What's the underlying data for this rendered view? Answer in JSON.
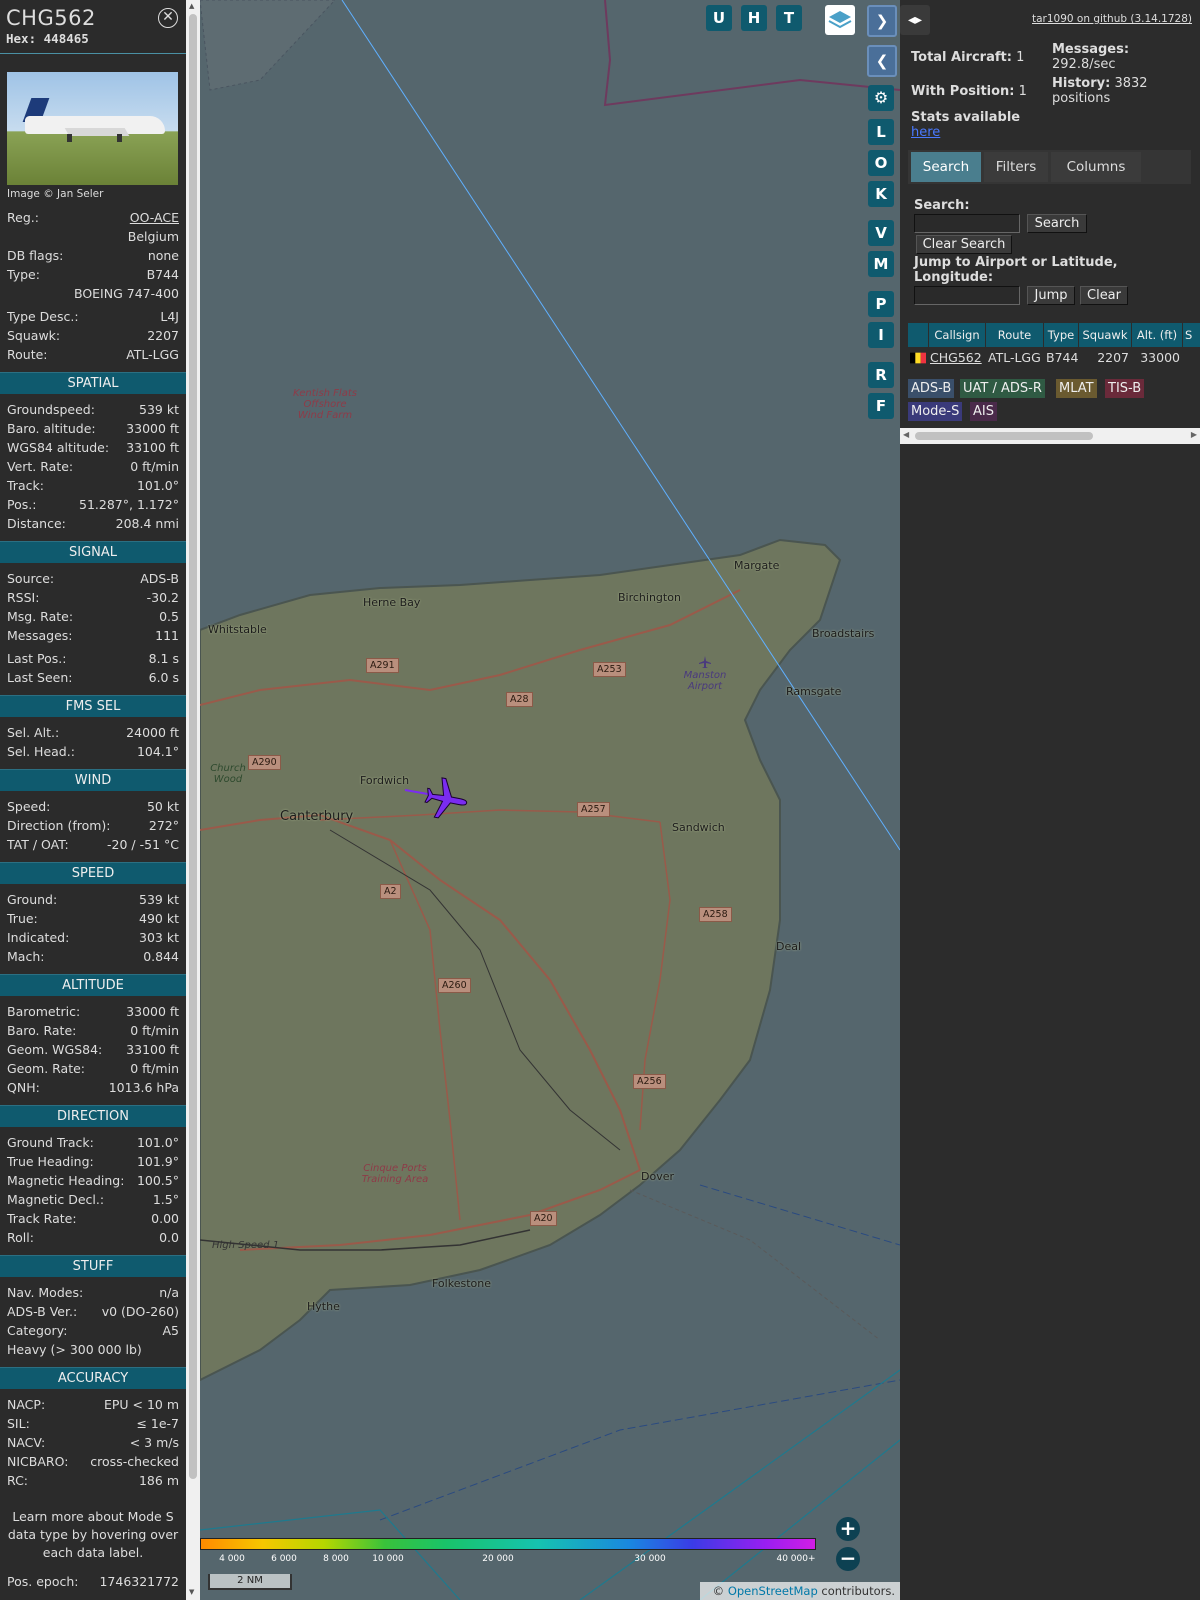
{
  "info": {
    "callsign": "CHG562",
    "hex_label": "Hex:",
    "hex": "448465",
    "close_icon": "x-circle-icon",
    "photo_credit": "Image © Jan Seler",
    "basic": [
      {
        "label": "Reg.:",
        "value": "OO-ACE"
      },
      {
        "value": "Belgium"
      },
      {
        "label": "DB flags:",
        "value": "none"
      },
      {
        "label": "Type:",
        "value": "B744"
      },
      {
        "value": "BOEING 747-400"
      },
      {
        "label": "Type Desc.:",
        "value": "L4J"
      },
      {
        "label": "Squawk:",
        "value": "2207"
      },
      {
        "label": "Route:",
        "value": "ATL-LGG"
      }
    ],
    "sections": [
      {
        "title": "SPATIAL",
        "rows": [
          {
            "label": "Groundspeed:",
            "value": "539 kt"
          },
          {
            "label": "Baro. altitude:",
            "value": "33000 ft"
          },
          {
            "label": "WGS84 altitude:",
            "value": "33100 ft"
          },
          {
            "label": "Vert. Rate:",
            "value": "0 ft/min"
          },
          {
            "label": "Track:",
            "value": "101.0°"
          },
          {
            "label": "Pos.:",
            "value": "51.287°, 1.172°"
          },
          {
            "label": "Distance:",
            "value": "208.4 nmi"
          }
        ]
      },
      {
        "title": "SIGNAL",
        "rows": [
          {
            "label": "Source:",
            "value": "ADS-B"
          },
          {
            "label": "RSSI:",
            "value": "-30.2"
          },
          {
            "label": "Msg. Rate:",
            "value": "0.5"
          },
          {
            "label": "Messages:",
            "value": "111"
          },
          {
            "label": "Last Pos.:",
            "value": "8.1 s"
          },
          {
            "label": "Last Seen:",
            "value": "6.0 s"
          }
        ]
      },
      {
        "title": "FMS SEL",
        "rows": [
          {
            "label": "Sel. Alt.:",
            "value": "24000 ft"
          },
          {
            "label": "Sel. Head.:",
            "value": "104.1°"
          }
        ]
      },
      {
        "title": "WIND",
        "rows": [
          {
            "label": "Speed:",
            "value": "50 kt"
          },
          {
            "label": "Direction (from):",
            "value": "272°"
          },
          {
            "label": "TAT / OAT:",
            "value": "-20 / -51 °C"
          }
        ]
      },
      {
        "title": "SPEED",
        "rows": [
          {
            "label": "Ground:",
            "value": "539 kt"
          },
          {
            "label": "True:",
            "value": "490 kt"
          },
          {
            "label": "Indicated:",
            "value": "303 kt"
          },
          {
            "label": "Mach:",
            "value": "0.844"
          }
        ]
      },
      {
        "title": "ALTITUDE",
        "rows": [
          {
            "label": "Barometric:",
            "value": "33000 ft"
          },
          {
            "label": "Baro. Rate:",
            "value": "0 ft/min"
          },
          {
            "label": "Geom. WGS84:",
            "value": "33100 ft"
          },
          {
            "label": "Geom. Rate:",
            "value": "0 ft/min"
          },
          {
            "label": "QNH:",
            "value": "1013.6 hPa"
          }
        ]
      },
      {
        "title": "DIRECTION",
        "rows": [
          {
            "label": "Ground Track:",
            "value": "101.0°"
          },
          {
            "label": "True Heading:",
            "value": "101.9°"
          },
          {
            "label": "Magnetic Heading:",
            "value": "100.5°"
          },
          {
            "label": "Magnetic Decl.:",
            "value": "1.5°"
          },
          {
            "label": "Track Rate:",
            "value": "0.00"
          },
          {
            "label": "Roll:",
            "value": "0.0"
          }
        ]
      },
      {
        "title": "STUFF",
        "rows": [
          {
            "label": "Nav. Modes:",
            "value": "n/a"
          },
          {
            "label": "ADS-B Ver.:",
            "value": "v0 (DO-260)"
          },
          {
            "label": "Category:",
            "value": "A5"
          },
          {
            "label": "Heavy (> 300 000 lb)",
            "value": ""
          }
        ]
      },
      {
        "title": "ACCURACY",
        "rows": [
          {
            "label": "NACP:",
            "value": "EPU < 10 m"
          },
          {
            "label": "SIL:",
            "value": "≤ 1e-7"
          },
          {
            "label": "NACV:",
            "value": "< 3 m/s"
          },
          {
            "label": "NICBARO:",
            "value": "cross-checked"
          },
          {
            "label": "RC:",
            "value": "186 m"
          }
        ]
      }
    ],
    "note": "Learn more about Mode S data type by hovering over each data label.",
    "epoch_label": "Pos. epoch:",
    "epoch_value": "1746321772"
  },
  "map": {
    "buttons_top": [
      "U",
      "H",
      "T"
    ],
    "layers_icon": "layers-icon",
    "side_buttons": [
      "L",
      "O",
      "K",
      "V",
      "M",
      "P",
      "I",
      "R",
      "F"
    ],
    "settings_icon": "gear-icon",
    "places": [
      {
        "name": "Margate"
      },
      {
        "name": "Birchington"
      },
      {
        "name": "Herne Bay"
      },
      {
        "name": "Whitstable"
      },
      {
        "name": "Broadstairs"
      },
      {
        "name": "Ramsgate"
      },
      {
        "name": "Manston Airport"
      },
      {
        "name": "Fordwich"
      },
      {
        "name": "Canterbury"
      },
      {
        "name": "Sandwich"
      },
      {
        "name": "Deal"
      },
      {
        "name": "Dover"
      },
      {
        "name": "Folkestone"
      },
      {
        "name": "Hythe"
      },
      {
        "name": "Church Wood"
      },
      {
        "name": "High Speed 1"
      }
    ],
    "areas": [
      "Kentish Flats Offshore Wind Farm",
      "Cinque Ports Training Area"
    ],
    "roads": [
      "A291",
      "A253",
      "A28",
      "A290",
      "A257",
      "A2",
      "A258",
      "A260",
      "A256",
      "A20"
    ],
    "altitude_ticks": [
      "4 000",
      "6 000",
      "8 000",
      "10 000",
      "20 000",
      "30 000",
      "40 000+"
    ],
    "scale": "2 NM",
    "attribution_prefix": "© ",
    "attribution_link": "OpenStreetMap",
    "attribution_suffix": " contributors.",
    "zoom_in": "+",
    "zoom_out": "−",
    "aircraft_icon": "aircraft-icon",
    "aircraft_color": "#7a2cf0"
  },
  "panel": {
    "toggle_icon": "expand-icon",
    "github_link": "tar1090 on github (3.14.1728)",
    "total_aircraft_label": "Total Aircraft:",
    "total_aircraft": "1",
    "with_position_label": "With Position:",
    "with_position": "1",
    "messages_label": "Messages:",
    "messages": "292.8/sec",
    "history_label": "History:",
    "history": "3832 positions",
    "stats_label": "Stats available",
    "stats_link": "here",
    "tabs": [
      "Search",
      "Filters",
      "Columns"
    ],
    "search_label": "Search:",
    "search_button": "Search",
    "clear_search_button": "Clear Search",
    "jump_label": "Jump to Airport or Latitude, Longitude:",
    "jump_button": "Jump",
    "clear_button": "Clear",
    "columns": [
      "Callsign",
      "Route",
      "Type",
      "Squawk",
      "Alt. (ft)",
      "S"
    ],
    "rows": [
      {
        "flag": "belgium-flag-icon",
        "callsign": "CHG562",
        "route": "ATL-LGG",
        "type": "B744",
        "squawk": "2207",
        "alt": "33000"
      }
    ],
    "sources": [
      {
        "label": "ADS-B",
        "color": "#3a4f6a"
      },
      {
        "label": "UAT / ADS-R",
        "color": "#2f5a43"
      },
      {
        "label": "MLAT",
        "color": "#6a5a30"
      },
      {
        "label": "TIS-B",
        "color": "#6a2a3a"
      },
      {
        "label": "Mode-S",
        "color": "#3a3a7a"
      },
      {
        "label": "AIS",
        "color": "#4a2a4a"
      }
    ]
  }
}
